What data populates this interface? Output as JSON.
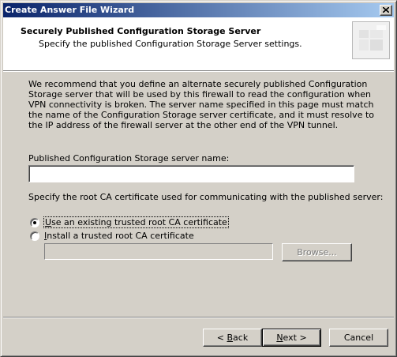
{
  "window": {
    "title": "Create Answer File Wizard"
  },
  "header": {
    "title": "Securely Published Configuration Storage Server",
    "subtitle": "Specify the published Configuration Storage Server settings."
  },
  "intro_text": "We recommend that you define an alternate securely published Configuration Storage server that will be used by this firewall to read the configuration when VPN connectivity is broken. The server name specified in this page must match the name of the Configuration Storage server certificate, and it must resolve to the IP address of the firewall server at the other end of the VPN tunnel.",
  "server_name": {
    "label": "Published Configuration Storage server name:",
    "value": ""
  },
  "ca": {
    "label": "Specify the root CA certificate used for communicating with the published server:",
    "options": [
      {
        "accel": "U",
        "rest": "se an existing trusted root CA certificate",
        "selected": true
      },
      {
        "accel": "I",
        "rest": "nstall a trusted root CA certificate",
        "selected": false
      }
    ],
    "path_value": "",
    "browse_label": "Browse..."
  },
  "buttons": {
    "back_prefix": "< ",
    "back_accel": "B",
    "back_rest": "ack",
    "next_accel": "N",
    "next_rest": "ext >",
    "cancel": "Cancel"
  },
  "icons": {
    "close": "close-icon",
    "header_logo": "wizard-logo-icon"
  }
}
